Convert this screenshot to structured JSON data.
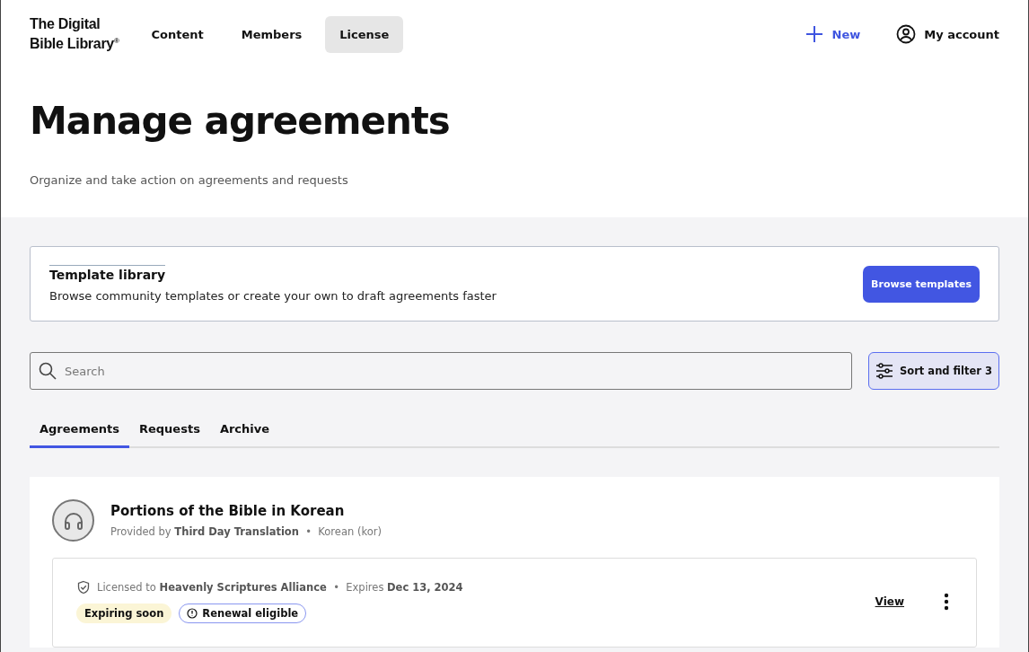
{
  "logo": {
    "lines": [
      "The Digital",
      "Bible Library$^{®}$"
    ]
  },
  "nav": [
    {
      "label": "Content",
      "selected": false
    },
    {
      "label": "Members",
      "selected": false
    },
    {
      "label": "License",
      "selected": true
    }
  ],
  "actions": {
    "new": "New",
    "account": "My account"
  },
  "page": {
    "title": "Manage agreements",
    "subtitle": "Organize and take action on agreements and requests"
  },
  "template_library": {
    "title": "Template library",
    "description": "Browse community templates or create your own to draft agreements faster",
    "button": "Browse templates"
  },
  "search": {
    "placeholder": "Search"
  },
  "filter_button": "Sort and filter 3",
  "tabs": [
    {
      "label": "Agreements",
      "selected": true
    },
    {
      "label": "Requests",
      "selected": false
    },
    {
      "label": "Archive",
      "selected": false
    }
  ],
  "items": [
    {
      "title": "Portions of the Bible in Korean",
      "meta": "Provided by **Third Day Translation**  •  Korean (kor)",
      "license": {
        "text": "Licensed to **Heavenly Scriptures Alliance**  •  Expires **Dec 13, 2024**",
        "badges": [
          {
            "kind": "warning",
            "label": "Expiring soon"
          },
          {
            "kind": "info",
            "label": "Renewal eligible"
          }
        ],
        "view": "View"
      }
    }
  ]
}
